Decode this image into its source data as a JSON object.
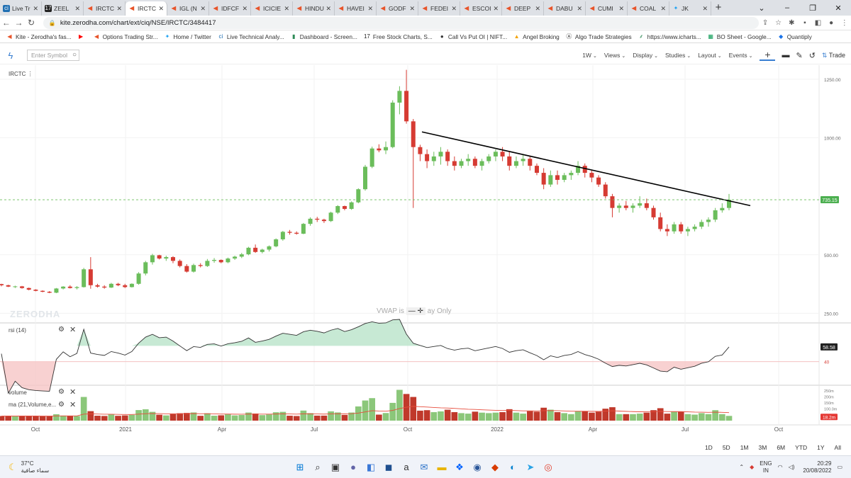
{
  "browser": {
    "tabs": [
      {
        "label": "Live Tr",
        "icon": "sq"
      },
      {
        "label": "ZEEL",
        "icon": "tv"
      },
      {
        "label": "IRCTC",
        "icon": "kite"
      },
      {
        "label": "IRCTC",
        "icon": "kite",
        "active": true
      },
      {
        "label": "IGL (N",
        "icon": "kite"
      },
      {
        "label": "IDFCF",
        "icon": "kite"
      },
      {
        "label": "ICICIE",
        "icon": "kite"
      },
      {
        "label": "HINDU",
        "icon": "kite"
      },
      {
        "label": "HAVEI",
        "icon": "kite"
      },
      {
        "label": "GODF",
        "icon": "kite"
      },
      {
        "label": "FEDEI",
        "icon": "kite"
      },
      {
        "label": "ESCOI",
        "icon": "kite"
      },
      {
        "label": "DEEP",
        "icon": "kite"
      },
      {
        "label": "DABU",
        "icon": "kite"
      },
      {
        "label": "CUMI",
        "icon": "kite"
      },
      {
        "label": "COAL",
        "icon": "kite"
      },
      {
        "label": "JK",
        "icon": "tw"
      }
    ],
    "url": "kite.zerodha.com/chart/ext/ciq/NSE/IRCTC/3484417",
    "bookmarks": [
      {
        "label": "Kite - Zerodha's fas...",
        "icon": "kite"
      },
      {
        "label": "",
        "icon": "yt"
      },
      {
        "label": "Options Trading Str...",
        "icon": "kite"
      },
      {
        "label": "Home / Twitter",
        "icon": "tw"
      },
      {
        "label": "Live Technical Analy...",
        "icon": "sq"
      },
      {
        "label": "Dashboard - Screen...",
        "icon": "bars"
      },
      {
        "label": "Free Stock Charts, S...",
        "icon": "tv"
      },
      {
        "label": "Call Vs Put OI | NIFT...",
        "icon": "dot"
      },
      {
        "label": "Angel Broking",
        "icon": "tri"
      },
      {
        "label": "Algo Trade Strategies",
        "icon": "a"
      },
      {
        "label": "https://www.icharts...",
        "icon": "ic"
      },
      {
        "label": "BO Sheet - Google...",
        "icon": "sheet"
      },
      {
        "label": "Quantiply",
        "icon": "q"
      }
    ]
  },
  "toolbar": {
    "symbol_placeholder": "Enter Symbol",
    "interval": "1W",
    "views": "Views",
    "display": "Display",
    "studies": "Studies",
    "layout": "Layout",
    "events": "Events",
    "trade": "Trade"
  },
  "chart": {
    "symbol": "IRCTC",
    "watermark": "ZERODHA",
    "vwap_left": "VWAP is",
    "vwap_right": "ay Only",
    "rsi_label": "rsi (14)",
    "volume_label": "volume",
    "ma_label": "ma (21,Volume,e...",
    "price_tag": "735.15",
    "rsi_tag": "58.58",
    "vol_tag": "18.2m",
    "rsi_mid": "40",
    "colors": {
      "up": "#6bbd5b",
      "down": "#d63b33",
      "trend": "#000000",
      "ma": "#e74c3c"
    }
  },
  "chart_data": {
    "type": "candlestick",
    "timeframe": "1W",
    "y_axis_ticks": [
      "1250.00",
      "1000.00",
      "500.00",
      "250.00"
    ],
    "volume_axis_ticks": [
      "250m",
      "200m",
      "150m",
      "100.0m"
    ],
    "x_axis_ticks": [
      "Oct",
      "2021",
      "Apr",
      "Jul",
      "Oct",
      "2022",
      "Apr",
      "Jul",
      "Oct"
    ],
    "ylim": [
      215,
      1310
    ],
    "last_price": 735.15,
    "last_rsi": 58.58,
    "last_volume_m": 18.2,
    "candles": [
      [
        [
          0.0,
          "2020-09-28"
        ],
        375,
        376,
        365,
        370
      ],
      [
        0.0,
        370,
        372,
        362,
        364
      ],
      [
        0.0,
        362,
        368,
        358,
        365
      ]
    ]
  },
  "range_buttons": [
    "1D",
    "5D",
    "1M",
    "3M",
    "6M",
    "YTD",
    "1Y",
    "All"
  ],
  "taskbar": {
    "temperature": "37°C",
    "weather_text": "سماء صافية",
    "lang_top": "ENG",
    "lang_bottom": "IN",
    "time": "20:29",
    "date": "20/08/2022"
  }
}
